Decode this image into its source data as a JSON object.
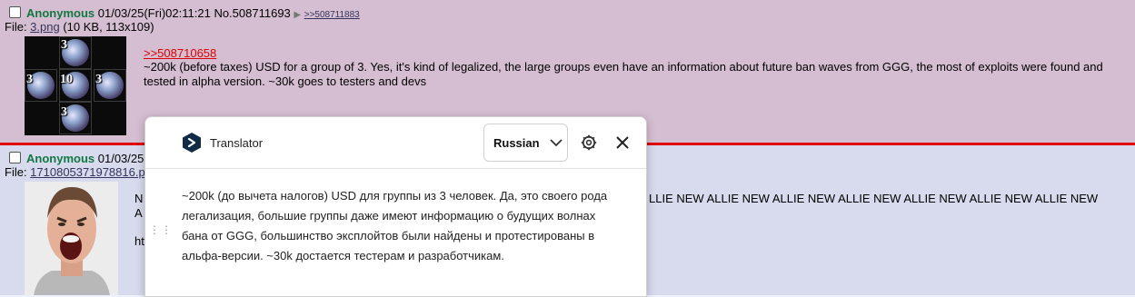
{
  "post1": {
    "name": "Anonymous",
    "datetime": "01/03/25(Fri)02:11:21",
    "post_no": "No.508711693",
    "arrow": "▶",
    "backlink": ">>508711883",
    "file_prefix": "File: ",
    "file_name": "3.png",
    "file_meta": " (10 KB, 113x109)",
    "thumb_numbers": [
      "3",
      "3",
      "10",
      "3",
      "3"
    ],
    "quotelink": ">>508710658",
    "message": "~200k (before taxes) USD for a group of 3. Yes, it's kind of legalized, the large groups even have an information about future ban waves from GGG, the most of exploits were found and tested in alpha version. ~30k goes to testers and devs"
  },
  "post2": {
    "name": "Anonymous",
    "datetime_partial": "01/03/25",
    "file_prefix": "File: ",
    "file_name_partial": "1710805371978816.p",
    "msg_stub1": "N",
    "msg_stub2": "A",
    "msg_stub3": "ht",
    "message_visible": "LLIE NEW ALLIE NEW ALLIE NEW ALLIE NEW ALLIE NEW ALLIE NEW ALLIE NEW"
  },
  "translator": {
    "title": "Translator",
    "language": "Russian",
    "text": "~200k (до вычета налогов) USD для группы из 3 человек. Да, это своего рода легализация, большие группы даже имеют информацию о будущих волнах бана от GGG, большинство эксплойтов были найдены и протестированы в альфа-версии. ~30k достается тестерам и разработчикам."
  },
  "colors": {
    "post1_bg": "#d6bed2",
    "post2_bg": "#d7dbed",
    "name": "#117743",
    "quotelink": "#dd0000",
    "separator": "#e00000"
  }
}
